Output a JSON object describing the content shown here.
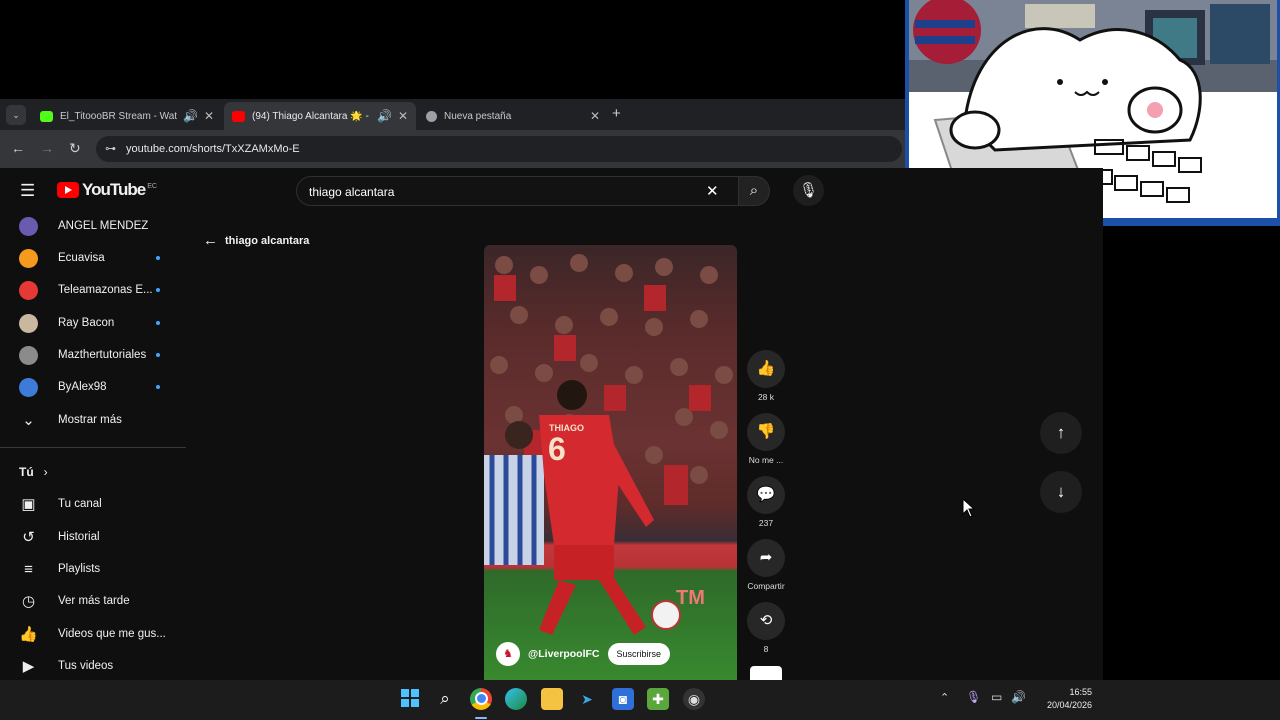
{
  "browser": {
    "tabs": [
      {
        "title": "El_TitoooBR Stream - Watc",
        "icon": "kick-icon",
        "color": "#53fc18",
        "sound": true
      },
      {
        "title": "(94) Thiago Alcantara 🌟 - ",
        "icon": "youtube-icon",
        "color": "#ff0000",
        "sound": true
      },
      {
        "title": "Nueva pestaña",
        "icon": "chrome-icon",
        "color": "#9aa0a6",
        "sound": false
      }
    ],
    "url": "youtube.com/shorts/TxXZAMxMo-E"
  },
  "youtube": {
    "logo_text": "YouTube",
    "country_code": "EC",
    "search_value": "thiago alcantara",
    "back_label": "thiago alcantara",
    "subscriptions": [
      {
        "name": "ANGEL MENDEZ",
        "color": "#6a5ab0",
        "dot": false
      },
      {
        "name": "Ecuavisa",
        "color": "#f59a1c",
        "dot": true
      },
      {
        "name": "Teleamazonas E...",
        "color": "#e53935",
        "dot": true
      },
      {
        "name": "Ray Bacon",
        "color": "#c9b7a0",
        "dot": true
      },
      {
        "name": "Mazthertutoriales",
        "color": "#8b8b8b",
        "dot": true
      },
      {
        "name": "ByAlex98",
        "color": "#3d7bd8",
        "dot": true
      }
    ],
    "show_more": "Mostrar más",
    "you_section": "Tú",
    "you_items": [
      {
        "label": "Tu canal",
        "icon": "account-box-icon",
        "glyph": "▣"
      },
      {
        "label": "Historial",
        "icon": "history-icon",
        "glyph": "↺"
      },
      {
        "label": "Playlists",
        "icon": "playlist-icon",
        "glyph": "≡"
      },
      {
        "label": "Ver más tarde",
        "icon": "clock-icon",
        "glyph": "◷"
      },
      {
        "label": "Videos que me gus...",
        "icon": "thumb-up-icon",
        "glyph": "👍"
      },
      {
        "label": "Tus videos",
        "icon": "video-icon",
        "glyph": "▶"
      }
    ],
    "short": {
      "channel": "@LiverpoolFC",
      "subscribe_label": "Suscribirse",
      "player_name": "THIAGO",
      "player_number": "6",
      "pitch_board": "TM"
    },
    "actions": [
      {
        "label": "28 k",
        "icon": "like-icon",
        "glyph": "👍"
      },
      {
        "label": "No me ...",
        "icon": "dislike-icon",
        "glyph": "👎"
      },
      {
        "label": "237",
        "icon": "comment-icon",
        "glyph": "💬"
      },
      {
        "label": "Compartir",
        "icon": "share-icon",
        "glyph": "➦"
      },
      {
        "label": "8",
        "icon": "remix-icon",
        "glyph": "⟲"
      }
    ]
  },
  "taskbar": {
    "time": "16:55",
    "date": "20/04/2026"
  }
}
